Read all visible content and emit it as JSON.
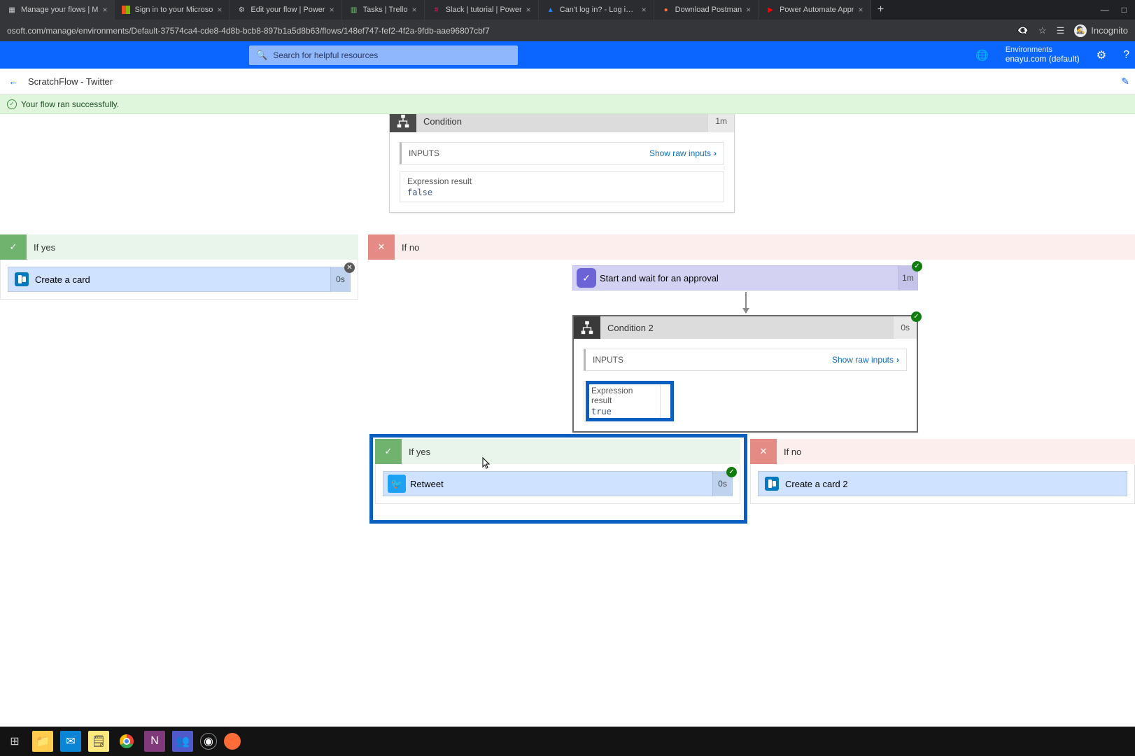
{
  "browser": {
    "tabs": [
      {
        "label": "Manage your flows | M",
        "close": "×"
      },
      {
        "label": "Sign in to your Microso",
        "close": "×"
      },
      {
        "label": "Edit your flow | Power",
        "close": "×"
      },
      {
        "label": "Tasks | Trello",
        "close": "×"
      },
      {
        "label": "Slack | tutorial | Power",
        "close": "×"
      },
      {
        "label": "Can't log in? - Log in w",
        "close": "×"
      },
      {
        "label": "Download Postman",
        "close": "×"
      },
      {
        "label": "Power Automate Appr",
        "close": "×"
      }
    ],
    "url": "osoft.com/manage/environments/Default-37574ca4-cde8-4d8b-bcb8-897b1a5d8b63/flows/148ef747-fef2-4f2a-9fdb-aae96807cbf7",
    "incognito_label": "Incognito"
  },
  "pa": {
    "search_placeholder": "Search for helpful resources",
    "env_label": "Environments",
    "env_value": "enayu.com (default)"
  },
  "flow": {
    "title": "ScratchFlow - Twitter",
    "success": "Your flow ran successfully."
  },
  "condition1": {
    "title": "Condition",
    "duration": "1m",
    "inputs_label": "INPUTS",
    "raw_link": "Show raw inputs",
    "expr_label": "Expression result",
    "expr_value": "false"
  },
  "left": {
    "if_yes": "If yes",
    "trello_action": "Create a card",
    "trello_dur": "0s"
  },
  "right": {
    "if_no": "If no",
    "approval": "Start and wait for an approval",
    "approval_dur": "1m"
  },
  "condition2": {
    "title": "Condition 2",
    "duration": "0s",
    "inputs_label": "INPUTS",
    "raw_link": "Show raw inputs",
    "expr_label": "Expression result",
    "expr_value": "true"
  },
  "nested": {
    "if_yes": "If yes",
    "retweet": "Retweet",
    "retweet_dur": "0s",
    "if_no": "If no",
    "create_card2": "Create a card 2"
  }
}
